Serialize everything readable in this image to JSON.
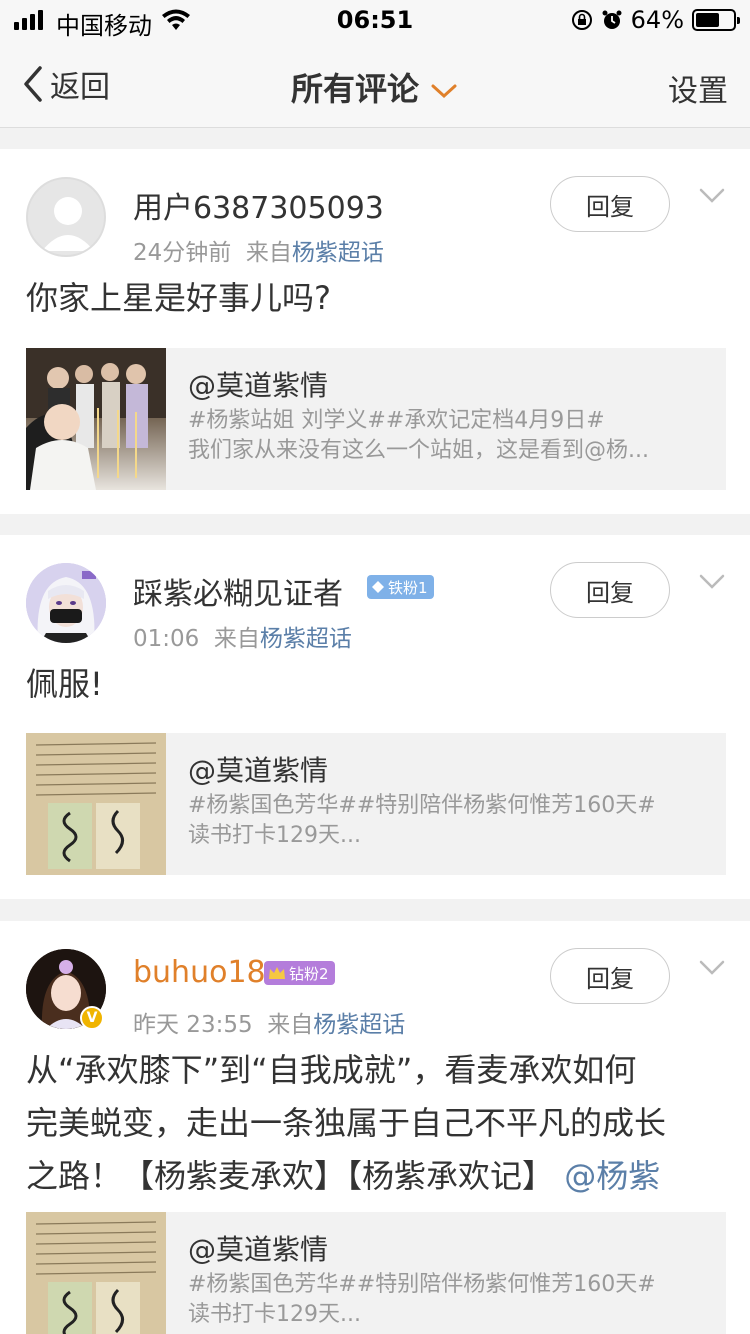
{
  "status_bar": {
    "carrier": "中国移动",
    "time": "06:51",
    "battery": "64%",
    "battery_level": 0.64
  },
  "nav": {
    "back_label": "返回",
    "title": "所有评论",
    "settings_label": "设置"
  },
  "comments": [
    {
      "username": "用户6387305093",
      "time": "24分钟前",
      "from_label": "来自",
      "source": "杨紫超话",
      "reply_label": "回复",
      "text": "你家上星是好事儿吗?",
      "quote": {
        "author": "@莫道紫情",
        "line1": "#杨紫站姐 刘学义##承欢记定档4月9日#",
        "line2": "我们家从来没有这么一个站姐，这是看到@杨..."
      }
    },
    {
      "username": "踩紫必糊见证者",
      "badge": "铁粉1",
      "time": "01:06",
      "from_label": "来自",
      "source": "杨紫超话",
      "reply_label": "回复",
      "text": "佩服!",
      "quote": {
        "author": "@莫道紫情",
        "line1": "#杨紫国色芳华##特别陪伴杨紫何惟芳160天#",
        "line2": "读书打卡129天..."
      }
    },
    {
      "username": "buhuo18",
      "badge": "钻粉2",
      "time": "昨天 23:55",
      "from_label": "来自",
      "source": "杨紫超话",
      "reply_label": "回复",
      "text_line1": "从“承欢膝下”到“自我成就”，看麦承欢如何",
      "text_line2": "完美蜕变，走出一条独属于自己不平凡的成长",
      "text_line3": "之路！【杨紫麦承欢】【杨紫承欢记】",
      "text_mention": "@杨紫",
      "quote": {
        "author": "@莫道紫情",
        "line1": "#杨紫国色芳华##特别陪伴杨紫何惟芳160天#",
        "line2": "读书打卡129天..."
      }
    }
  ],
  "colors": {
    "link": "#5b7fa8",
    "accent_orange": "#e0802a",
    "meta_gray": "#999999",
    "background": "#f2f2f2"
  },
  "icons": [
    "signal-icon",
    "wifi-icon",
    "rotation-lock-icon",
    "alarm-icon",
    "battery-icon",
    "back-chevron-icon",
    "dropdown-chevron-icon",
    "more-chevron-icon",
    "verified-icon",
    "crown-icon",
    "diamond-icon"
  ]
}
